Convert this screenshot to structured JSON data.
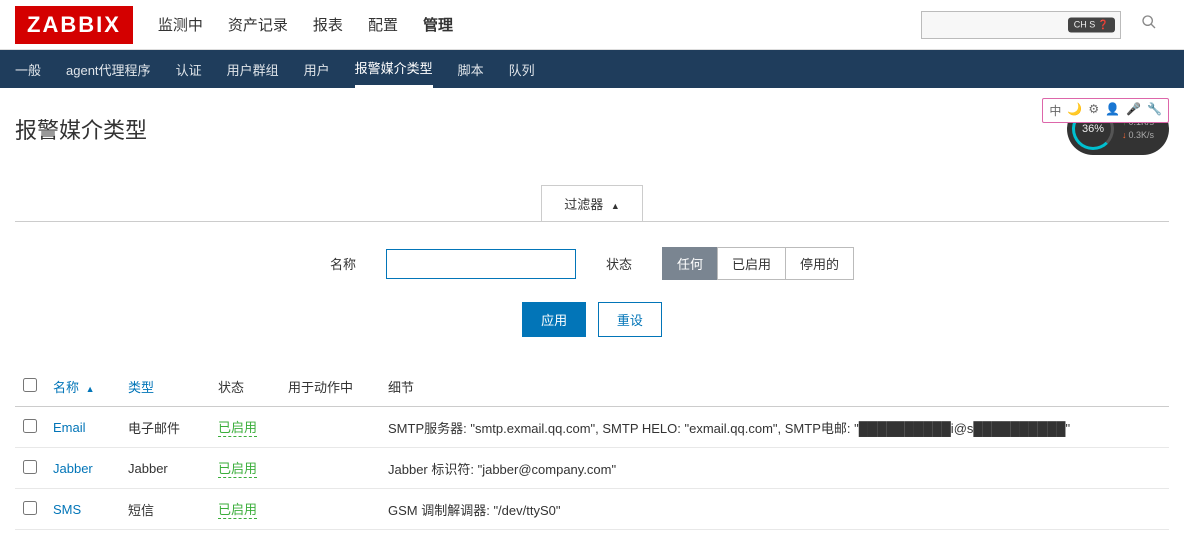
{
  "logo": "ZABBIX",
  "top_nav": {
    "items": [
      "监测中",
      "资产记录",
      "报表",
      "配置",
      "管理"
    ],
    "active_index": 4
  },
  "search": {
    "ime_badge": "CH S ❓",
    "placeholder": ""
  },
  "sub_nav": {
    "items": [
      "一般",
      "agent代理程序",
      "认证",
      "用户群组",
      "用户",
      "报警媒介类型",
      "脚本",
      "队列"
    ],
    "active_index": 5
  },
  "tool_pill": [
    "中",
    "🌙",
    "⚙",
    "👤",
    "🎤",
    "🔧"
  ],
  "page_title": "报警媒介类型",
  "gauge": {
    "percent": "36%",
    "up": "0.1K/s",
    "down": "0.3K/s"
  },
  "filter": {
    "tab_label": "过滤器",
    "name_label": "名称",
    "name_value": "",
    "status_label": "状态",
    "status_options": [
      "任何",
      "已启用",
      "停用的"
    ],
    "status_active_index": 0,
    "apply_label": "应用",
    "reset_label": "重设"
  },
  "table": {
    "headers": {
      "name": "名称",
      "type": "类型",
      "status": "状态",
      "used_in": "用于动作中",
      "details": "细节"
    },
    "sort_asc_on": "name",
    "rows": [
      {
        "name": "Email",
        "type": "电子邮件",
        "status": "已启用",
        "used_in": "",
        "details": "SMTP服务器: \"smtp.exmail.qq.com\", SMTP HELO: \"exmail.qq.com\", SMTP电邮: \"██████████i@s██████████\""
      },
      {
        "name": "Jabber",
        "type": "Jabber",
        "status": "已启用",
        "used_in": "",
        "details": "Jabber 标识符: \"jabber@company.com\""
      },
      {
        "name": "SMS",
        "type": "短信",
        "status": "已启用",
        "used_in": "",
        "details": "GSM 调制解调器: \"/dev/ttyS0\""
      }
    ]
  }
}
